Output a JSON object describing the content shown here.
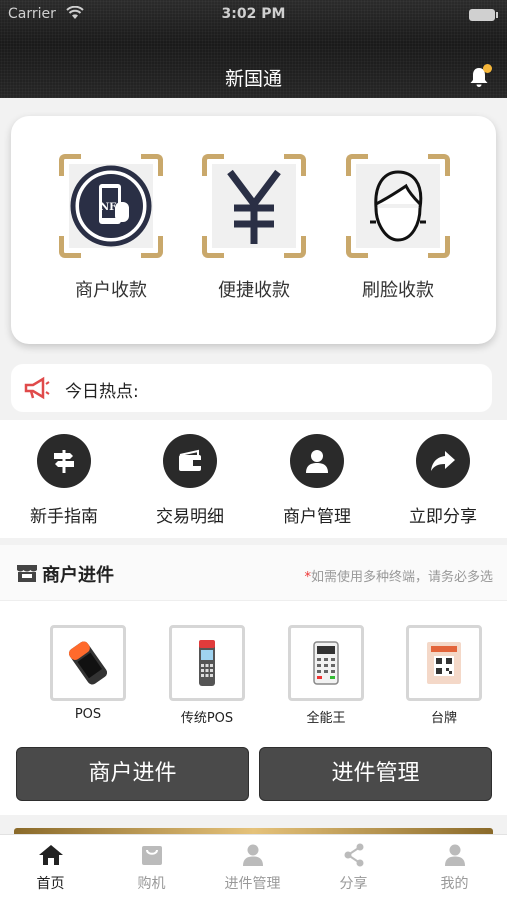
{
  "status_bar": {
    "carrier": "Carrier",
    "time": "3:02 PM"
  },
  "header": {
    "title": "新国通"
  },
  "payments": [
    {
      "label": "商户收款",
      "icon": "nfc-phone-icon"
    },
    {
      "label": "便捷收款",
      "icon": "yuan-icon"
    },
    {
      "label": "刷脸收款",
      "icon": "face-icon"
    }
  ],
  "hot_news": {
    "label": "今日热点:"
  },
  "quick_menu": [
    {
      "label": "新手指南",
      "icon": "signpost-icon"
    },
    {
      "label": "交易明细",
      "icon": "wallet-icon"
    },
    {
      "label": "商户管理",
      "icon": "person-icon"
    },
    {
      "label": "立即分享",
      "icon": "share-arrow-icon"
    }
  ],
  "merchant": {
    "title": "商户进件",
    "note_star": "*",
    "note": "如需使用多种终端，请务必多选",
    "devices": [
      {
        "label": "POS",
        "icon": "pos-terminal-icon"
      },
      {
        "label": "传统POS",
        "icon": "traditional-pos-icon"
      },
      {
        "label": "全能王",
        "icon": "all-in-one-icon"
      },
      {
        "label": "台牌",
        "icon": "qr-stand-icon"
      }
    ],
    "primary_button": "商户进件",
    "secondary_button": "进件管理"
  },
  "tabbar": [
    {
      "label": "首页",
      "icon": "home-icon",
      "active": true
    },
    {
      "label": "购机",
      "icon": "cart-icon",
      "active": false
    },
    {
      "label": "进件管理",
      "icon": "user-icon",
      "active": false
    },
    {
      "label": "分享",
      "icon": "share-icon",
      "active": false
    },
    {
      "label": "我的",
      "icon": "profile-icon",
      "active": false
    }
  ],
  "colors": {
    "accent_gold": "#c9a86b",
    "dark": "#2a2a2a",
    "button": "#4a4a4a"
  }
}
